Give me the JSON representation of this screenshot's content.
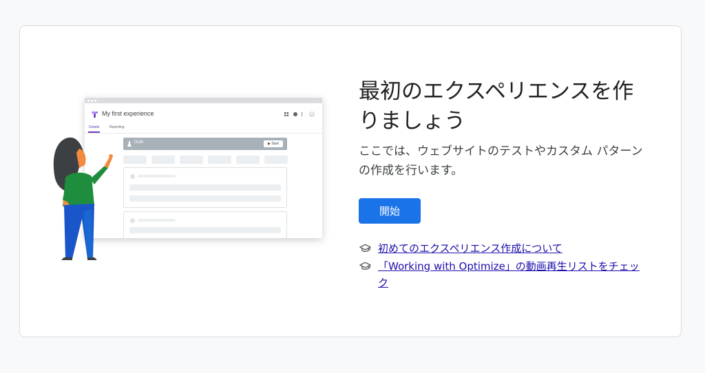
{
  "card": {
    "heading": "最初のエクスペリエンスを作りましょう",
    "description": "ここでは、ウェブサイトのテストやカスタム パターンの作成を行います。",
    "start_button": "開始",
    "links": [
      {
        "text": " 初めてのエクスペリエンス作成について",
        "icon": "graduation-cap-icon"
      },
      {
        "text": " 「Working with Optimize」の動画再生リストをチェック",
        "icon": "graduation-cap-icon"
      }
    ]
  },
  "illustration": {
    "title": "My first experience",
    "tabs": [
      "Details",
      "Reporting"
    ],
    "status": "Draft",
    "start": "Start"
  },
  "colors": {
    "primary": "#1a73e8",
    "link": "#1a0dab",
    "accent_purple": "#673ab7",
    "page_background": "#f8f9fa"
  }
}
